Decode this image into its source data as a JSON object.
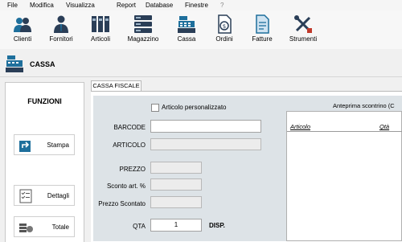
{
  "menu": [
    "File",
    "Modifica",
    "Visualizza",
    "Report",
    "Database",
    "Finestre",
    "?"
  ],
  "toolbar": [
    {
      "label": "Clienti",
      "icon": "clients-icon"
    },
    {
      "label": "Fornitori",
      "icon": "suppliers-icon"
    },
    {
      "label": "Articoli",
      "icon": "articles-icon"
    },
    {
      "label": "Magazzino",
      "icon": "warehouse-icon"
    },
    {
      "label": "Cassa",
      "icon": "cash-register-icon"
    },
    {
      "label": "Ordini",
      "icon": "orders-icon"
    },
    {
      "label": "Fatture",
      "icon": "invoices-icon"
    },
    {
      "label": "Strumenti",
      "icon": "tools-icon"
    }
  ],
  "window_title": "CASSA",
  "functions": {
    "title": "FUNZIONI",
    "buttons": [
      {
        "label": "Stampa",
        "icon": "print-icon"
      },
      {
        "label": "Dettagli",
        "icon": "details-icon"
      },
      {
        "label": "Totale",
        "icon": "total-icon"
      }
    ]
  },
  "tab_label": "CASSA FISCALE",
  "form": {
    "custom_article_label": "Articolo personalizzato",
    "barcode_label": "BARCODE",
    "barcode_value": "",
    "article_label": "ARTICOLO",
    "article_value": "",
    "price_label": "PREZZO",
    "price_value": "",
    "discount_label": "Sconto art. %",
    "discount_value": "",
    "discounted_price_label": "Prezzo Scontato",
    "discounted_price_value": "",
    "qty_label": "QTA",
    "qty_value": "1",
    "disp_label": "DISP."
  },
  "preview": {
    "title": "Anteprima scontrino (C",
    "col_article": "Articolo",
    "col_qty": "Qtà"
  },
  "colors": {
    "accent": "#1e6f9c",
    "form_bg": "#dde3e7"
  }
}
